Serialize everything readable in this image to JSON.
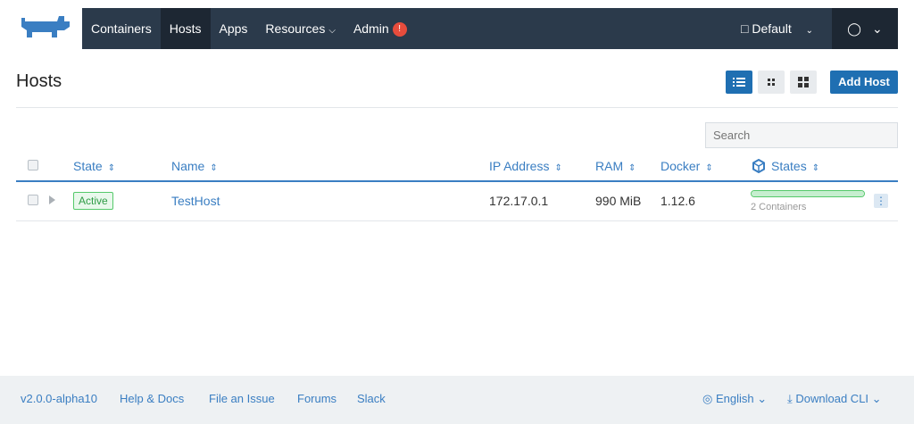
{
  "nav": {
    "items": [
      {
        "label": "Containers"
      },
      {
        "label": "Hosts",
        "active": true
      },
      {
        "label": "Apps"
      },
      {
        "label": "Resources"
      },
      {
        "label": "Admin",
        "badge": "!"
      }
    ],
    "environment": "Default"
  },
  "page": {
    "title": "Hosts",
    "add_button": "Add Host",
    "search_placeholder": "Search"
  },
  "table": {
    "columns": [
      "State",
      "Name",
      "IP Address",
      "RAM",
      "Docker",
      "States"
    ],
    "rows": [
      {
        "state": "Active",
        "name": "TestHost",
        "ip": "172.17.0.1",
        "ram": "990 MiB",
        "docker": "1.12.6",
        "states_summary": "2 Containers",
        "progress_fraction": 1.0
      }
    ]
  },
  "footer": {
    "version": "v2.0.0-alpha10",
    "help": "Help & Docs",
    "issue": "File an Issue",
    "forums": "Forums",
    "slack": "Slack",
    "language": "English",
    "download": "Download CLI"
  },
  "colors": {
    "nav_bg": "#2b3a4b",
    "accent": "#1f6fb2",
    "link": "#3a7ec2",
    "success": "#55c96a",
    "danger": "#e74c3c"
  }
}
